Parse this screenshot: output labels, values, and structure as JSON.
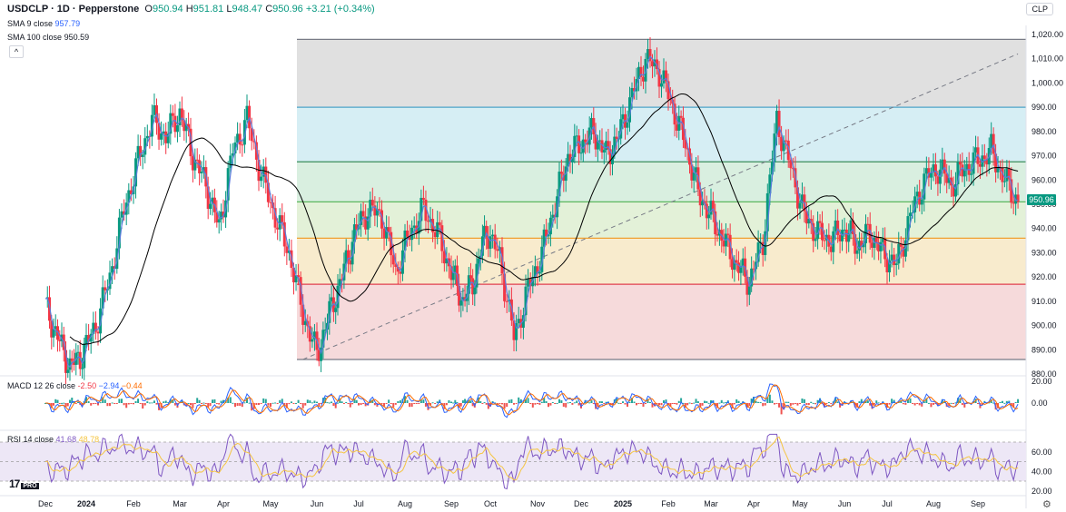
{
  "header": {
    "symbol": "USDCLP · 1D · Pepperstone",
    "open_label": "O",
    "open": "950.94",
    "high_label": "H",
    "high": "951.81",
    "low_label": "L",
    "low": "948.47",
    "close_label": "C",
    "close": "950.96",
    "change": "+3.21 (+0.34%)"
  },
  "indicators": {
    "sma9_label": "SMA 9 close",
    "sma9_value": "957.79",
    "sma100_label": "SMA 100 close",
    "sma100_value": "950.59",
    "macd_label": "MACD 12 26 close",
    "macd_hist": "-2.50",
    "macd_line": "−2.94",
    "macd_signal": "−0.44",
    "rsi_label": "RSI 14 close",
    "rsi_value": "41.68",
    "rsi_ma": "48.78"
  },
  "currency_button": "CLP",
  "collapse_icon": "chevron-up-icon",
  "settings_icon": "gear-icon",
  "logo": {
    "text": "17",
    "pro": "PRO"
  },
  "colors": {
    "up": "#089981",
    "down": "#f23645",
    "sma9": "#5b7ddb",
    "sma100": "#000000",
    "macd": "#2962ff",
    "signal": "#ff6d00",
    "rsi": "#7e57c2",
    "rsi_ma": "#f5c542"
  },
  "chart_data": {
    "type": "candlestick",
    "title": "USDCLP · 1D · Pepperstone",
    "price_axis": {
      "ticks": [
        "1,020.00",
        "1,010.00",
        "1,000.00",
        "990.00",
        "980.00",
        "970.00",
        "960.00",
        "950.00",
        "940.00",
        "930.00",
        "920.00",
        "910.00",
        "900.00",
        "890.00",
        "880.00"
      ],
      "range": [
        880,
        1023
      ]
    },
    "time_axis": {
      "labels": [
        "Dec",
        "2024",
        "Feb",
        "Mar",
        "Apr",
        "May",
        "Jun",
        "Jul",
        "Aug",
        "Sep",
        "Oct",
        "Nov",
        "Dec",
        "2025",
        "Feb",
        "Mar",
        "Apr",
        "May",
        "Jun",
        "Jul",
        "Aug",
        "Sep"
      ]
    },
    "last_price": "950.96",
    "fibonacci_levels": [
      1018.0,
      990.0,
      967.5,
      951.0,
      936.0,
      917.0,
      886.0
    ],
    "fib_zones": [
      {
        "from": 1018.0,
        "to": 990.0,
        "color": "#e0e0e0"
      },
      {
        "from": 990.0,
        "to": 967.5,
        "color": "#d6eef4"
      },
      {
        "from": 967.5,
        "to": 951.0,
        "color": "#d9efe0"
      },
      {
        "from": 951.0,
        "to": 936.0,
        "color": "#e3f1d8"
      },
      {
        "from": 936.0,
        "to": 917.0,
        "color": "#f8ebcd"
      },
      {
        "from": 917.0,
        "to": 886.0,
        "color": "#f6dadb"
      }
    ],
    "fib_line_colors": [
      "#787b86",
      "#4fa3c8",
      "#3b8e5c",
      "#4caf50",
      "#f0a030",
      "#e04050",
      "#787b86"
    ],
    "trendline": {
      "from_month_index": 5.7,
      "from_price": 886,
      "to_month_index": 21.9,
      "to_price": 1012
    },
    "close_path": [
      [
        0,
        908
      ],
      [
        0.3,
        895
      ],
      [
        0.6,
        883
      ],
      [
        0.9,
        888
      ],
      [
        1.2,
        900
      ],
      [
        1.5,
        920
      ],
      [
        1.8,
        948
      ],
      [
        2.1,
        968
      ],
      [
        2.4,
        985
      ],
      [
        2.7,
        978
      ],
      [
        3.0,
        988
      ],
      [
        3.3,
        970
      ],
      [
        3.6,
        958
      ],
      [
        3.9,
        940
      ],
      [
        4.2,
        972
      ],
      [
        4.5,
        985
      ],
      [
        4.8,
        962
      ],
      [
        5.1,
        945
      ],
      [
        5.4,
        930
      ],
      [
        5.7,
        905
      ],
      [
        6.0,
        888
      ],
      [
        6.3,
        905
      ],
      [
        6.6,
        920
      ],
      [
        6.9,
        938
      ],
      [
        7.2,
        948
      ],
      [
        7.5,
        945
      ],
      [
        7.8,
        922
      ],
      [
        8.1,
        938
      ],
      [
        8.4,
        948
      ],
      [
        8.7,
        938
      ],
      [
        9.0,
        922
      ],
      [
        9.3,
        910
      ],
      [
        9.6,
        920
      ],
      [
        9.9,
        940
      ],
      [
        10.2,
        928
      ],
      [
        10.5,
        895
      ],
      [
        10.8,
        915
      ],
      [
        11.1,
        930
      ],
      [
        11.4,
        950
      ],
      [
        11.7,
        970
      ],
      [
        12.0,
        975
      ],
      [
        12.3,
        980
      ],
      [
        12.6,
        970
      ],
      [
        12.9,
        978
      ],
      [
        13.2,
        995
      ],
      [
        13.5,
        1010
      ],
      [
        13.8,
        1005
      ],
      [
        14.1,
        990
      ],
      [
        14.4,
        975
      ],
      [
        14.7,
        955
      ],
      [
        15.0,
        945
      ],
      [
        15.3,
        935
      ],
      [
        15.6,
        925
      ],
      [
        15.9,
        918
      ],
      [
        16.2,
        935
      ],
      [
        16.5,
        985
      ],
      [
        16.8,
        965
      ],
      [
        17.1,
        945
      ],
      [
        17.4,
        938
      ],
      [
        17.7,
        935
      ],
      [
        18.0,
        940
      ],
      [
        18.3,
        933
      ],
      [
        18.6,
        938
      ],
      [
        18.9,
        930
      ],
      [
        19.2,
        925
      ],
      [
        19.5,
        945
      ],
      [
        19.8,
        960
      ],
      [
        20.1,
        965
      ],
      [
        20.4,
        958
      ],
      [
        20.7,
        965
      ],
      [
        21.0,
        968
      ],
      [
        21.3,
        972
      ],
      [
        21.6,
        960
      ],
      [
        21.9,
        950.96
      ]
    ]
  }
}
